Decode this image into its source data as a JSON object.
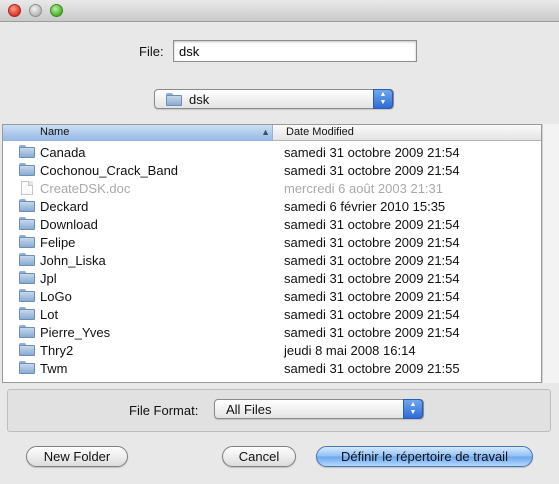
{
  "file": {
    "label": "File:",
    "value": "dsk"
  },
  "directory": {
    "selected": "dsk"
  },
  "table": {
    "headers": {
      "name": "Name",
      "date": "Date Modified"
    },
    "rows": [
      {
        "name": "Canada",
        "date": "samedi 31 octobre 2009 21:54",
        "icon": "folder-icon"
      },
      {
        "name": "Cochonou_Crack_Band",
        "date": "samedi 31 octobre 2009 21:54",
        "icon": "folder-icon"
      },
      {
        "name": "CreateDSK.doc",
        "date": "mercredi 6 août 2003 21:31",
        "icon": "document-icon"
      },
      {
        "name": "Deckard",
        "date": "samedi 6 février 2010 15:35",
        "icon": "folder-icon"
      },
      {
        "name": "Download",
        "date": "samedi 31 octobre 2009 21:54",
        "icon": "folder-icon"
      },
      {
        "name": "Felipe",
        "date": "samedi 31 octobre 2009 21:54",
        "icon": "folder-icon"
      },
      {
        "name": "John_Liska",
        "date": "samedi 31 octobre 2009 21:54",
        "icon": "folder-icon"
      },
      {
        "name": "Jpl",
        "date": "samedi 31 octobre 2009 21:54",
        "icon": "folder-icon"
      },
      {
        "name": "LoGo",
        "date": "samedi 31 octobre 2009 21:54",
        "icon": "folder-icon"
      },
      {
        "name": "Lot",
        "date": "samedi 31 octobre 2009 21:54",
        "icon": "folder-icon"
      },
      {
        "name": "Pierre_Yves",
        "date": "samedi 31 octobre 2009 21:54",
        "icon": "folder-icon"
      },
      {
        "name": "Thry2",
        "date": "jeudi 8 mai 2008 16:14",
        "icon": "folder-icon"
      },
      {
        "name": "Twm",
        "date": "samedi 31 octobre 2009 21:55",
        "icon": "folder-icon"
      }
    ]
  },
  "format": {
    "label": "File Format:",
    "selected": "All Files"
  },
  "buttons": {
    "new_folder": "New Folder",
    "cancel": "Cancel",
    "primary": "Définir le répertoire de travail"
  }
}
